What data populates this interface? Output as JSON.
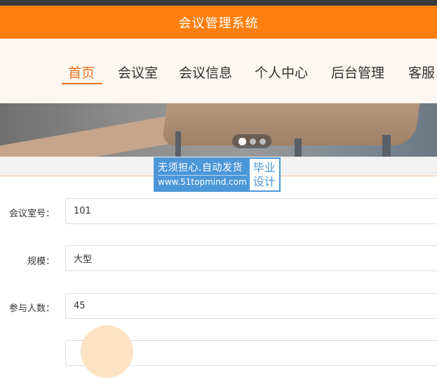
{
  "header": {
    "title": "会议管理系统"
  },
  "nav": {
    "items": [
      {
        "label": "首页",
        "active": true
      },
      {
        "label": "会议室",
        "active": false
      },
      {
        "label": "会议信息",
        "active": false
      },
      {
        "label": "个人中心",
        "active": false
      },
      {
        "label": "后台管理",
        "active": false
      },
      {
        "label": "客服",
        "active": false
      }
    ]
  },
  "carousel": {
    "slides": 3,
    "current": 1
  },
  "watermark": {
    "line1": "无须担心.自动发货",
    "line2": "www.51topmind.com",
    "side1": "毕业",
    "side2": "设计"
  },
  "form": {
    "room_no": {
      "label": "会议室号：",
      "value": "101"
    },
    "scale": {
      "label": "规模：",
      "value": "大型"
    },
    "attendees": {
      "label": "参与人数：",
      "value": "45"
    },
    "next": {
      "value": ""
    }
  },
  "colors": {
    "accent": "#ff7f0e",
    "nav_active": "#e8711d",
    "watermark": "#4b97d8"
  }
}
